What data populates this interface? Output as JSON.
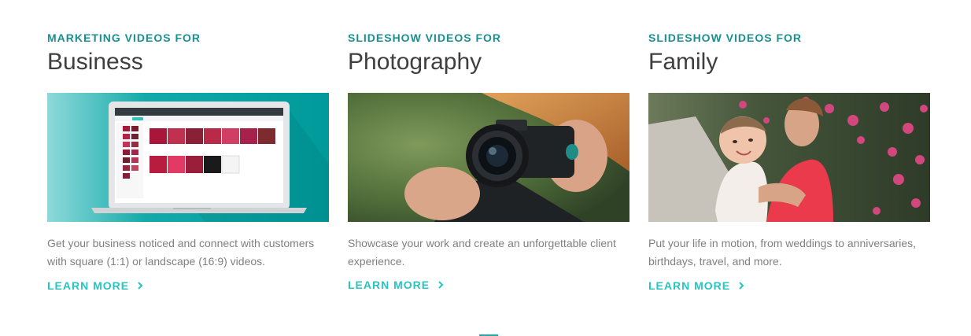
{
  "cards": [
    {
      "eyebrow": "MARKETING VIDEOS FOR",
      "title": "Business",
      "image": "laptop-editor-screenshot",
      "description": "Get your business noticed and connect with customers with square (1:1) or landscape (16:9) videos.",
      "link": "LEARN MORE",
      "link_icon": "chevron-right-icon"
    },
    {
      "eyebrow": "SLIDESHOW VIDEOS FOR",
      "title": "Photography",
      "image": "photographer-holding-camera",
      "description": "Showcase your work and create an unforgettable client experience.",
      "link": "LEARN MORE",
      "link_icon": "chevron-right-icon"
    },
    {
      "eyebrow": "SLIDESHOW VIDEOS FOR",
      "title": "Family",
      "image": "mother-kissing-baby",
      "description": "Put your life in motion, from weddings to anniversaries, birthdays, travel, and more.",
      "link": "LEARN MORE",
      "link_icon": "chevron-right-icon"
    }
  ],
  "colors": {
    "eyebrow": "#1a8f90",
    "title": "#3f3f3f",
    "body": "#808080",
    "link": "#27c4c2",
    "teal_bg": "#0aa5a7"
  }
}
